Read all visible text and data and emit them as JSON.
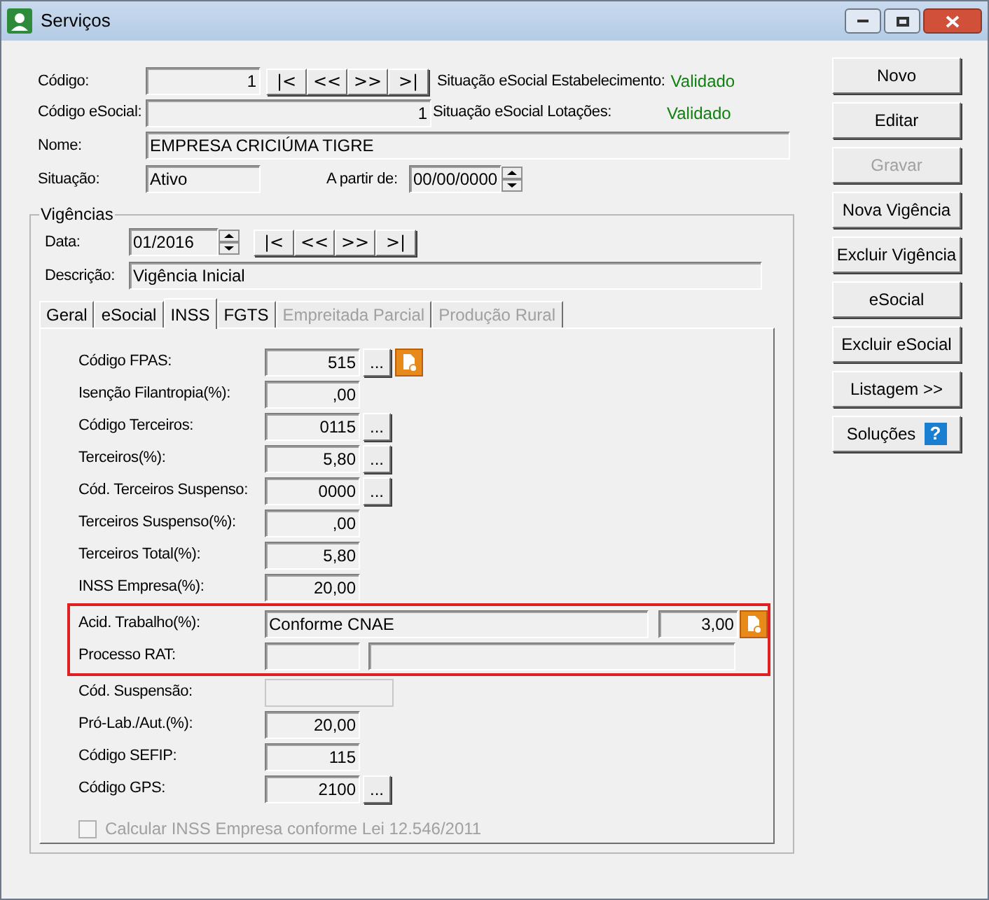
{
  "window": {
    "title": "Serviços"
  },
  "header": {
    "codigo": {
      "label": "Código:",
      "value": "1"
    },
    "nav": [
      "|<",
      "<<",
      ">>",
      ">|"
    ],
    "status_estab": {
      "label": "Situação eSocial Estabelecimento:",
      "value": "Validado"
    },
    "codigo_esocial": {
      "label": "Código eSocial:",
      "value": "1"
    },
    "status_lotacoes": {
      "label": "Situação eSocial Lotações:",
      "value": "Validado"
    },
    "nome": {
      "label": "Nome:",
      "value": "EMPRESA CRICIÚMA TIGRE"
    },
    "situacao": {
      "label": "Situação:",
      "value": "Ativo"
    },
    "a_partir_de": {
      "label": "A partir de:",
      "value": "00/00/0000"
    }
  },
  "vigencias": {
    "title": "Vigências",
    "data": {
      "label": "Data:",
      "value": "01/2016"
    },
    "nav": [
      "|<",
      "<<",
      ">>",
      ">|"
    ],
    "descricao": {
      "label": "Descrição:",
      "value": "Vigência Inicial"
    },
    "tabs": [
      {
        "label": "Geral",
        "selected": false,
        "disabled": false
      },
      {
        "label": "eSocial",
        "selected": false,
        "disabled": false
      },
      {
        "label": "INSS",
        "selected": true,
        "disabled": false
      },
      {
        "label": "FGTS",
        "selected": false,
        "disabled": false
      },
      {
        "label": "Empreitada Parcial",
        "selected": false,
        "disabled": true
      },
      {
        "label": "Produção Rural",
        "selected": false,
        "disabled": true
      }
    ],
    "sections": [
      {
        "highlighted": false,
        "rows": [
          {
            "kind": "field",
            "label": "Código FPAS:",
            "value": "515",
            "lookup": "...",
            "report": true
          },
          {
            "kind": "field",
            "label": "Isenção Filantropia(%):",
            "value": ",00"
          },
          {
            "kind": "field",
            "label": "Código Terceiros:",
            "value": "0115",
            "lookup": "..."
          },
          {
            "kind": "field",
            "label": "Terceiros(%):",
            "value": "5,80",
            "lookup": "..."
          },
          {
            "kind": "field",
            "label": "Cód. Terceiros Suspenso:",
            "value": "0000",
            "lookup": "..."
          },
          {
            "kind": "field",
            "label": "Terceiros Suspenso(%):",
            "value": ",00"
          },
          {
            "kind": "field",
            "label": "Terceiros Total(%):",
            "value": "5,80"
          },
          {
            "kind": "field",
            "label": "INSS Empresa(%):",
            "value": "20,00"
          }
        ]
      },
      {
        "highlighted": true,
        "rows": [
          {
            "kind": "acid",
            "label": "Acid. Trabalho(%):",
            "text": "Conforme CNAE",
            "value": "3,00",
            "report": true
          },
          {
            "kind": "pair",
            "label": "Processo RAT:"
          }
        ]
      },
      {
        "highlighted": false,
        "rows": [
          {
            "kind": "wide",
            "label": "Cód. Suspensão:"
          },
          {
            "kind": "field",
            "label": "Pró-Lab./Aut.(%):",
            "value": "20,00"
          },
          {
            "kind": "field",
            "label": "Código SEFIP:",
            "value": "115"
          },
          {
            "kind": "field",
            "label": "Código GPS:",
            "value": "2100",
            "lookup": "..."
          }
        ]
      }
    ],
    "checkbox": {
      "label": "Calcular INSS Empresa conforme Lei 12.546/2011",
      "checked": false,
      "disabled": true
    }
  },
  "buttons": [
    {
      "label": "Novo",
      "disabled": false
    },
    {
      "label": "Editar",
      "disabled": false
    },
    {
      "label": "Gravar",
      "disabled": true
    },
    {
      "label": "Nova Vigência",
      "disabled": false
    },
    {
      "label": "Excluir Vigência",
      "disabled": false
    },
    {
      "label": "eSocial",
      "disabled": false
    },
    {
      "label": "Excluir eSocial",
      "disabled": false
    },
    {
      "label": "Listagem >>",
      "disabled": false
    },
    {
      "label": "Soluções",
      "disabled": false,
      "help": "?"
    }
  ]
}
